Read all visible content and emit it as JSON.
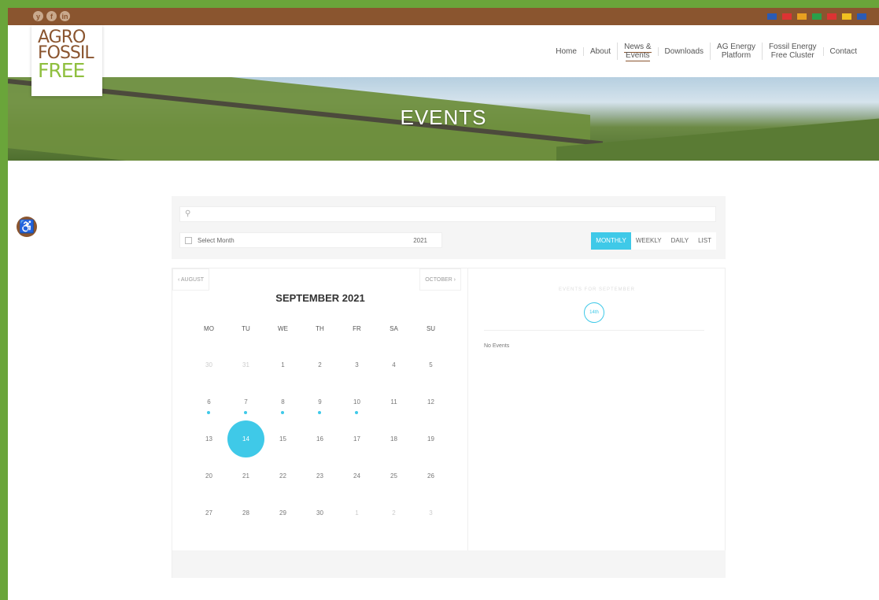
{
  "social": [
    "y",
    "f",
    "in"
  ],
  "flags": [
    "#2b5bb5",
    "#d33",
    "#e8a020",
    "#2aa04a",
    "#d33",
    "#f0c020",
    "#2b5bb5"
  ],
  "logo": {
    "line1": "AGRO",
    "line2": "FOSSIL",
    "line3": "FREE"
  },
  "nav": [
    {
      "label": "Home"
    },
    {
      "label": "About"
    },
    {
      "label": "News &\nEvents"
    },
    {
      "label": "Downloads"
    },
    {
      "label": "AG Energy\nPlatform"
    },
    {
      "label": "Fossil Energy\nFree Cluster"
    },
    {
      "label": "Contact"
    }
  ],
  "hero": {
    "title": "EVENTS"
  },
  "filters": {
    "search_placeholder": "",
    "month_label": "Select Month",
    "year": "2021",
    "views": [
      "MONTHLY",
      "WEEKLY",
      "DAILY",
      "LIST"
    ],
    "active_view": "MONTHLY"
  },
  "calendar": {
    "prev": "‹ AUGUST",
    "next": "OCTOBER ›",
    "heading": "SEPTEMBER 2021",
    "dow": [
      "MO",
      "TU",
      "WE",
      "TH",
      "FR",
      "SA",
      "SU"
    ],
    "days": [
      {
        "d": "30",
        "o": 1
      },
      {
        "d": "31",
        "o": 1
      },
      {
        "d": "1"
      },
      {
        "d": "2"
      },
      {
        "d": "3"
      },
      {
        "d": "4"
      },
      {
        "d": "5"
      },
      {
        "d": "6",
        "e": 1
      },
      {
        "d": "7",
        "e": 1
      },
      {
        "d": "8",
        "e": 1
      },
      {
        "d": "9",
        "e": 1
      },
      {
        "d": "10",
        "e": 1
      },
      {
        "d": "11"
      },
      {
        "d": "12"
      },
      {
        "d": "13"
      },
      {
        "d": "14",
        "t": 1
      },
      {
        "d": "15"
      },
      {
        "d": "16"
      },
      {
        "d": "17"
      },
      {
        "d": "18"
      },
      {
        "d": "19"
      },
      {
        "d": "20"
      },
      {
        "d": "21"
      },
      {
        "d": "22"
      },
      {
        "d": "23"
      },
      {
        "d": "24"
      },
      {
        "d": "25"
      },
      {
        "d": "26"
      },
      {
        "d": "27"
      },
      {
        "d": "28"
      },
      {
        "d": "29"
      },
      {
        "d": "30"
      },
      {
        "d": "1",
        "o": 1
      },
      {
        "d": "2",
        "o": 1
      },
      {
        "d": "3",
        "o": 1
      }
    ],
    "events_title": "EVENTS FOR SEPTEMBER",
    "selected_day": "14th",
    "no_events": "No Events"
  }
}
